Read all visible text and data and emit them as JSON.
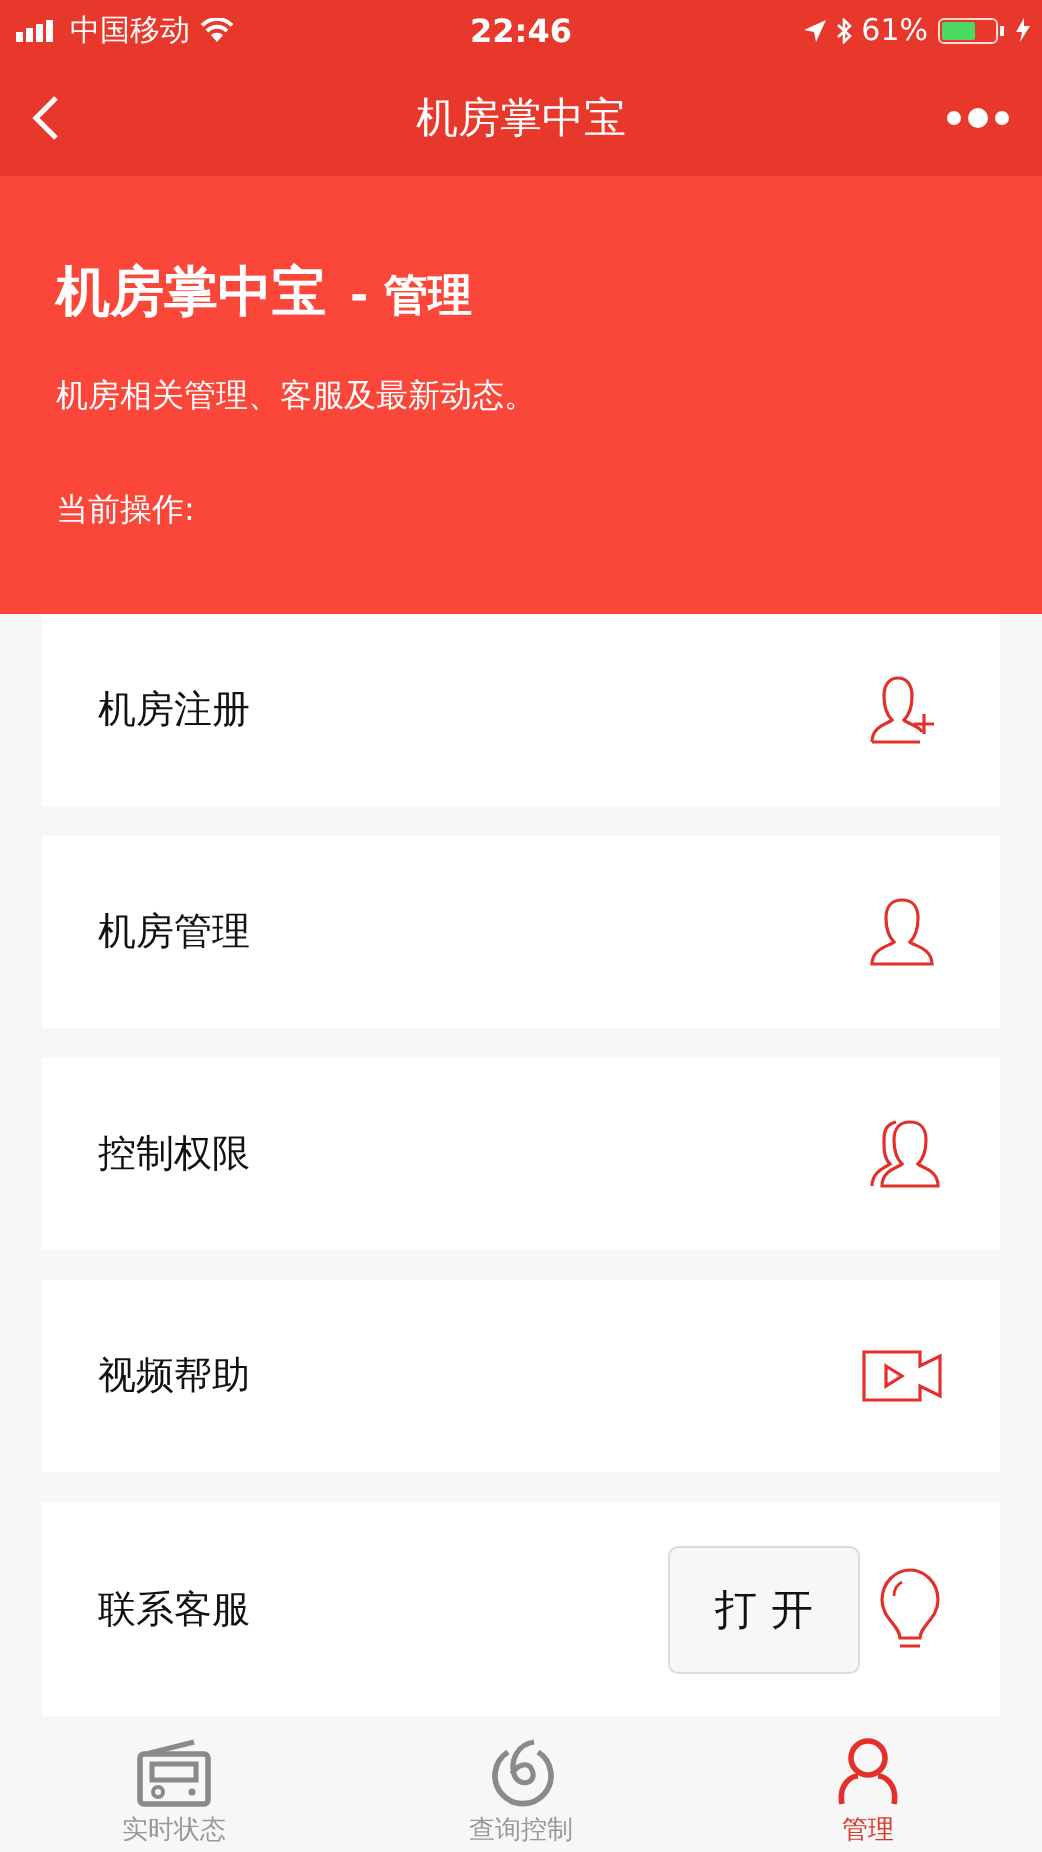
{
  "status_bar": {
    "carrier": "中国移动",
    "time": "22:46",
    "battery": "61%"
  },
  "nav": {
    "title": "机房掌中宝"
  },
  "header": {
    "title": "机房掌中宝",
    "subtitle": "- 管理",
    "description": "机房相关管理、客服及最新动态。",
    "current_label": "当前操作:"
  },
  "items": [
    {
      "label": "机房注册"
    },
    {
      "label": "机房管理"
    },
    {
      "label": "控制权限"
    },
    {
      "label": "视频帮助"
    },
    {
      "label": "联系客服",
      "button": "打 开"
    }
  ],
  "tabs": [
    {
      "label": "实时状态",
      "selected": false
    },
    {
      "label": "查询控制",
      "selected": false
    },
    {
      "label": "管理",
      "selected": true
    }
  ]
}
